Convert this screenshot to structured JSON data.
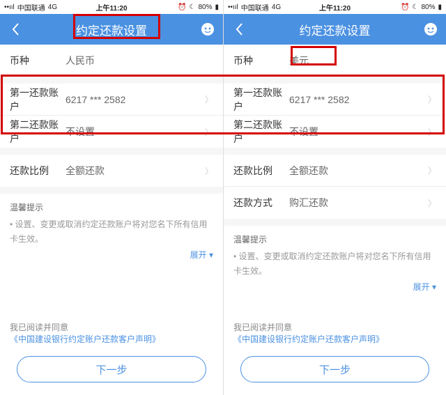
{
  "status": {
    "carrier": "中国联通",
    "network": "4G",
    "time": "上午11:20",
    "alarm": "⏰",
    "do_not": "☾",
    "battery_pct": "80%"
  },
  "left": {
    "nav_title": "约定还款设置",
    "currency_label": "币种",
    "currency_value": "人民币",
    "acc1_label": "第一还款账户",
    "acc1_value": "6217 *** 2582",
    "acc2_label": "第二还款账户",
    "acc2_value": "不设置",
    "ratio_label": "还款比例",
    "ratio_value": "全额还款",
    "tip_title": "温馨提示",
    "tip_text": "• 设置、变更或取消约定还款账户将对您名下所有信用卡生效。",
    "expand": "展开 ▾",
    "agree_text": "我已阅读并同意",
    "agree_link": "《中国建设银行约定账户还款客户声明》",
    "next": "下一步"
  },
  "right": {
    "nav_title": "约定还款设置",
    "currency_label": "币种",
    "currency_value": "美元",
    "acc1_label": "第一还款账户",
    "acc1_value": "6217 *** 2582",
    "acc2_label": "第二还款账户",
    "acc2_value": "不设置",
    "ratio_label": "还款比例",
    "ratio_value": "全额还款",
    "method_label": "还款方式",
    "method_value": "购汇还款",
    "tip_title": "温馨提示",
    "tip_text": "• 设置、变更或取消约定还款账户将对您名下所有信用卡生效。",
    "expand": "展开 ▾",
    "agree_text": "我已阅读并同意",
    "agree_link": "《中国建设银行约定账户还款客户声明》",
    "next": "下一步"
  }
}
